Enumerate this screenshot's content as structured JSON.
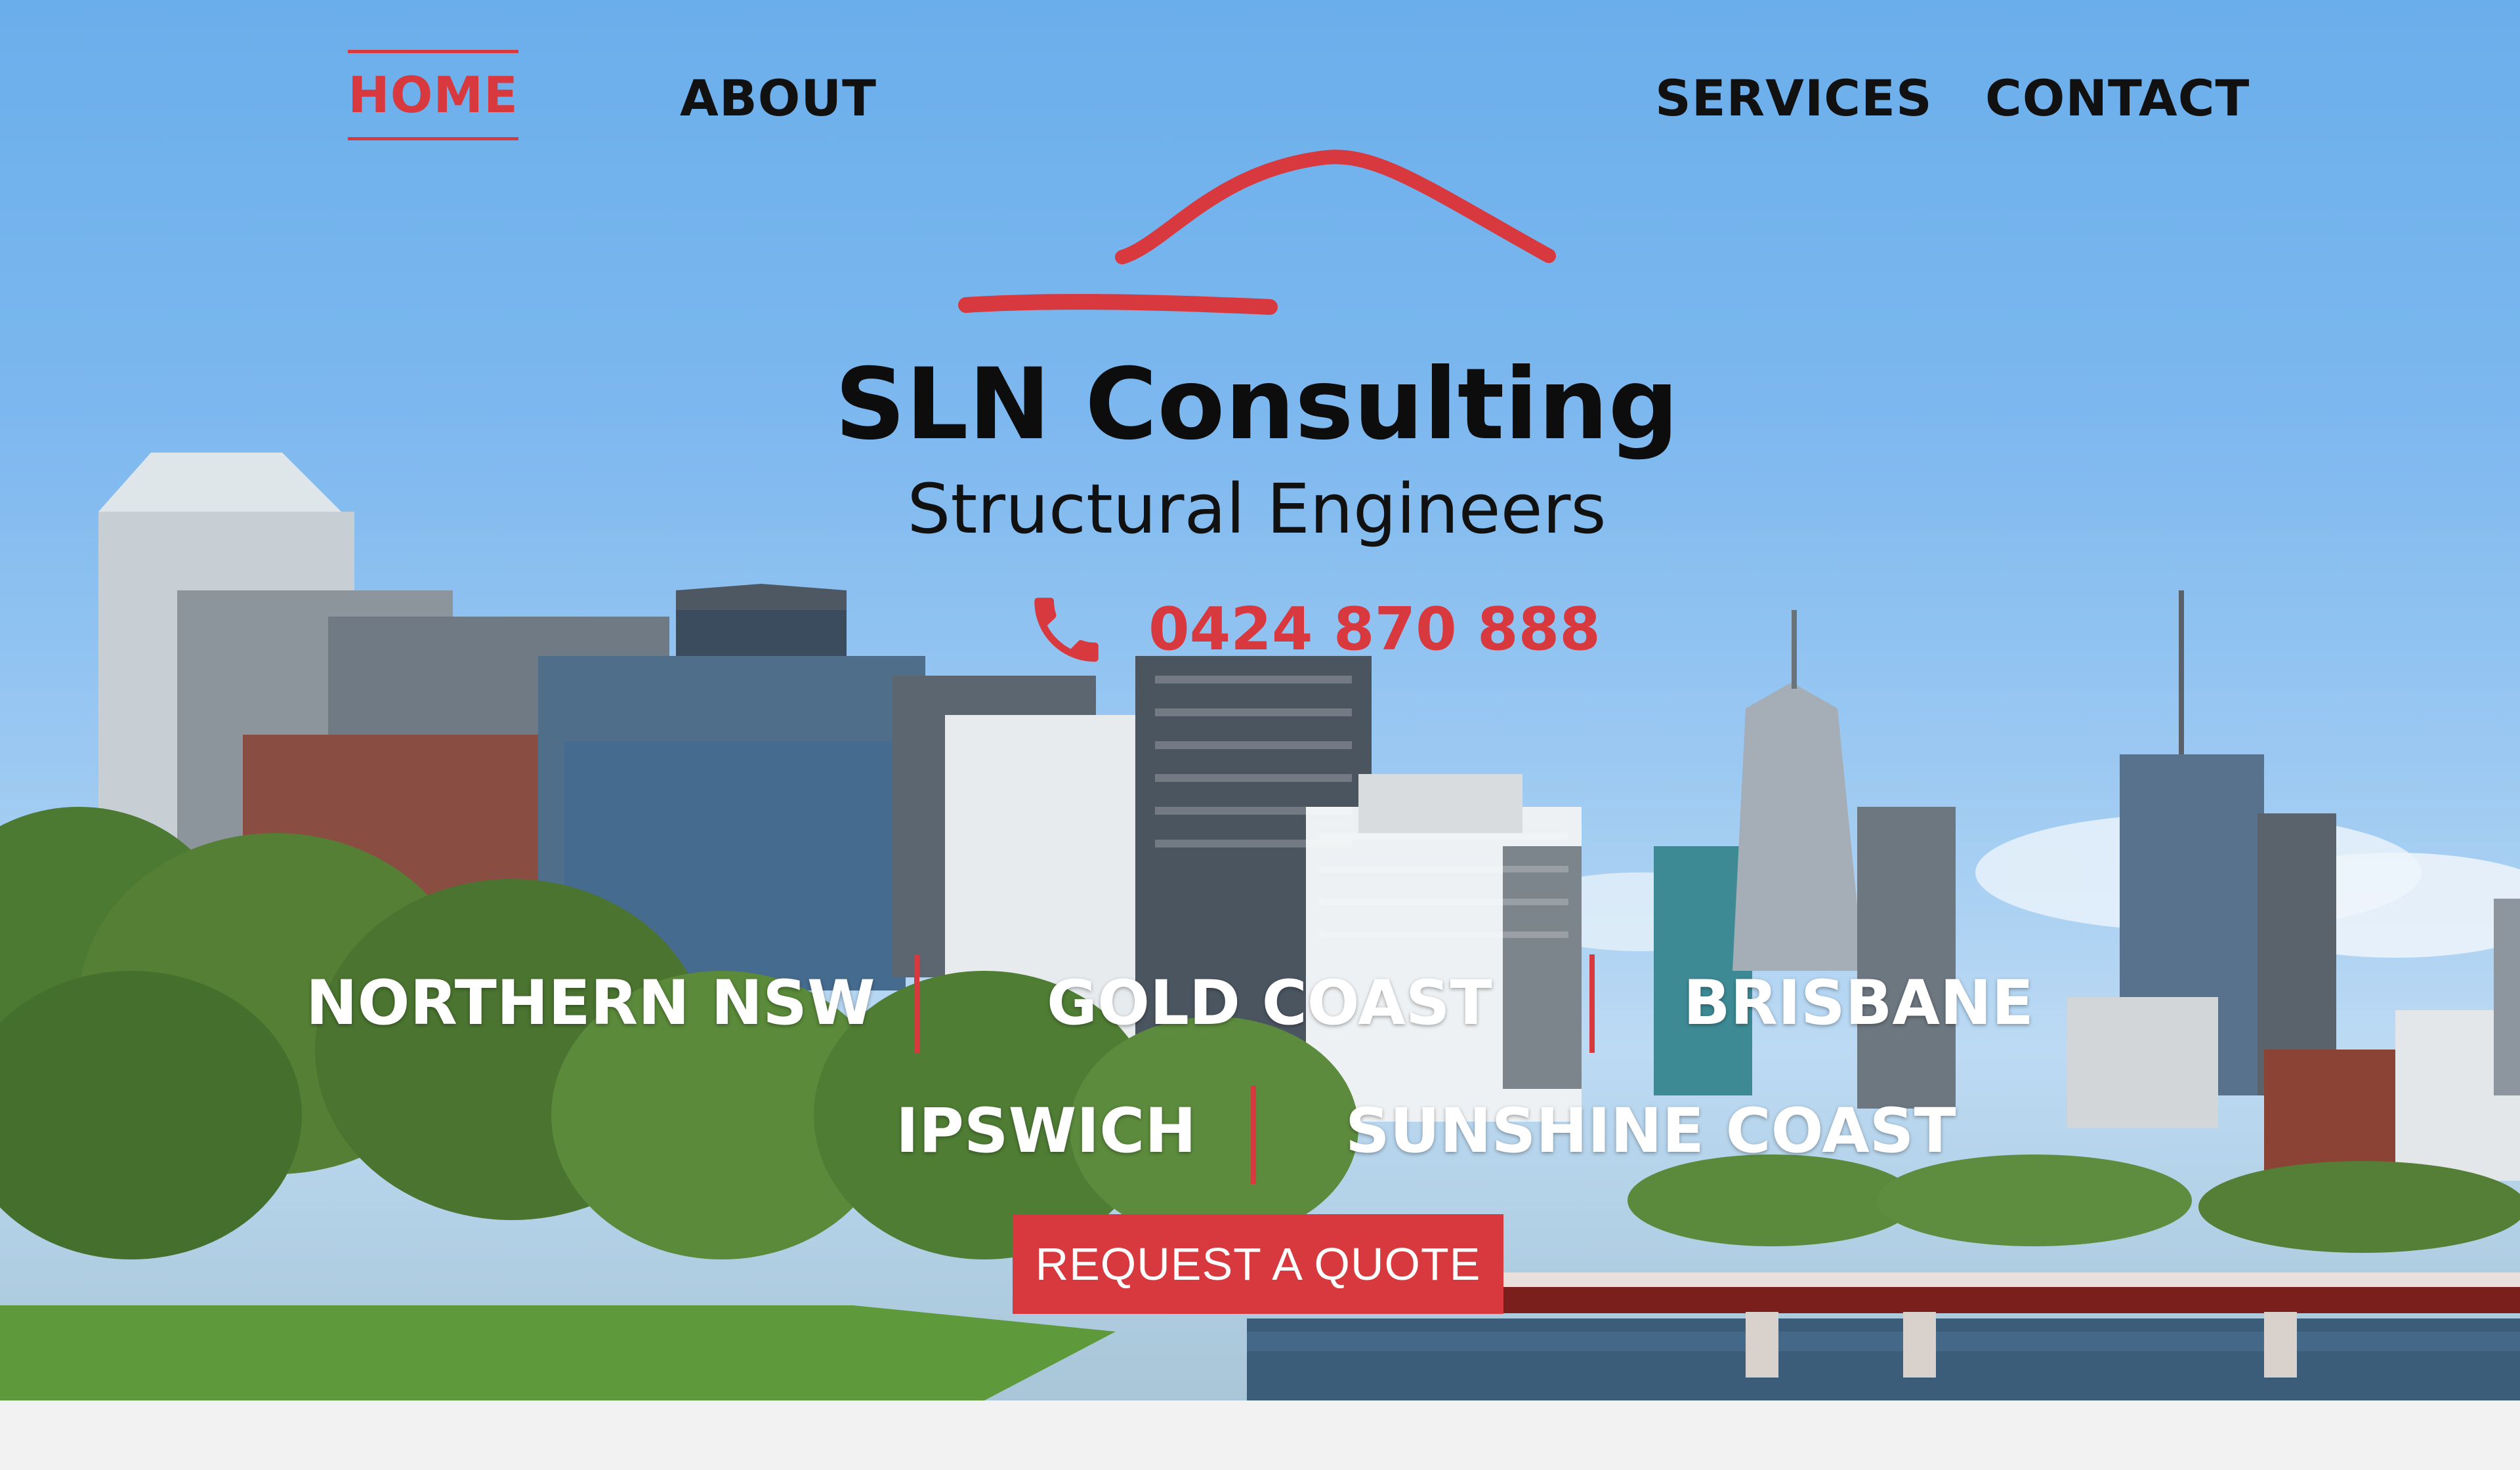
{
  "nav": {
    "home": "HOME",
    "about": "ABOUT",
    "services": "SERVICES",
    "contact": "CONTACT"
  },
  "brand": {
    "title": "SLN Consulting",
    "subtitle": "Structural Engineers",
    "phone": "0424 870 888"
  },
  "regions": {
    "row1": [
      "NORTHERN NSW",
      "GOLD COAST",
      "BRISBANE"
    ],
    "row2": [
      "IPSWICH",
      "SUNSHINE COAST"
    ]
  },
  "cta": {
    "label": "REQUEST A QUOTE"
  },
  "icons": {
    "phone": "phone-icon",
    "logo": "roof-logo-mark"
  },
  "colors": {
    "accent": "#d8393e",
    "text_dark": "#111111",
    "region_text": "#ffffff"
  }
}
